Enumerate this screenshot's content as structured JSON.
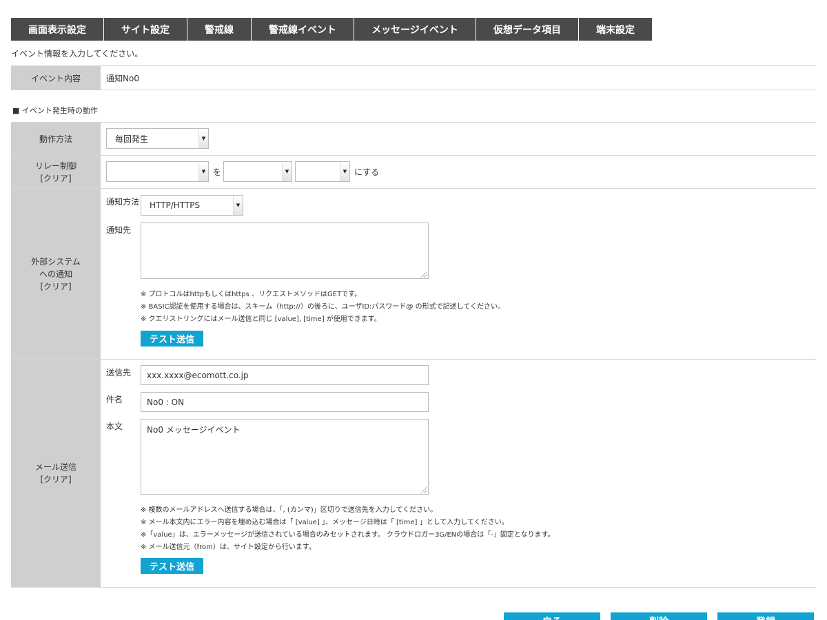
{
  "tabs": [
    {
      "label": "画面表示設定"
    },
    {
      "label": "サイト設定"
    },
    {
      "label": "警戒線"
    },
    {
      "label": "警戒線イベント"
    },
    {
      "label": "メッセージイベント"
    },
    {
      "label": "仮想データ項目"
    },
    {
      "label": "端末設定"
    }
  ],
  "intro_text": "イベント情報を入力してください。",
  "event_content": {
    "label": "イベント内容",
    "value": "通知No0"
  },
  "section_title": "■ イベント発生時の動作",
  "operation": {
    "label": "動作方法",
    "selected": "毎回発生"
  },
  "relay": {
    "label": "リレー制御",
    "clear": "[クリア]",
    "select1": "",
    "connector": "を",
    "select2": "",
    "select3": "",
    "suffix": "にする"
  },
  "external": {
    "label_line1": "外部システム",
    "label_line2": "への通知",
    "clear": "[クリア]",
    "method_label": "通知方法",
    "method_value": "HTTP/HTTPS",
    "dest_label": "通知先",
    "dest_value": "",
    "notes": [
      "※ プロトコルはhttpもしくはhttps 、リクエストメソッドはGETです。",
      "※ BASIC認証を使用する場合は、スキーム（http://）の後ろに、ユーザID:パスワード@ の形式で記述してください。",
      "※ クエリストリングにはメール送信と同じ [value], [time] が使用できます。"
    ],
    "test_button": "テスト送信"
  },
  "mail": {
    "label": "メール送信",
    "clear": "[クリア]",
    "to_label": "送信先",
    "to_value": "xxx.xxxx@ecomott.co.jp",
    "subject_label": "件名",
    "subject_value": "No0 : ON",
    "body_label": "本文",
    "body_value": "No0 メッセージイベント",
    "notes": [
      "※ 複数のメールアドレスへ送信する場合は、「, (カンマ)」区切りで送信先を入力してください。",
      "※ メール本文内にエラー内容を埋め込む場合は「 [value] 」、メッセージ日時は「 [time] 」として入力してください。",
      "※「value」は、エラーメッセージが送信されている場合のみセットされます。 クラウドロガー3G/ENの場合は「-」固定となります。",
      "※ メール送信元（from）は、サイト設定から行います。"
    ],
    "test_button": "テスト送信"
  },
  "footer": {
    "back_button": "戻る",
    "delete_button": "削除",
    "register_button": "登録"
  },
  "colors": {
    "tab_bg": "#4a4a4a",
    "label_bg": "#cfcfcf",
    "accent": "#12a3d0"
  }
}
